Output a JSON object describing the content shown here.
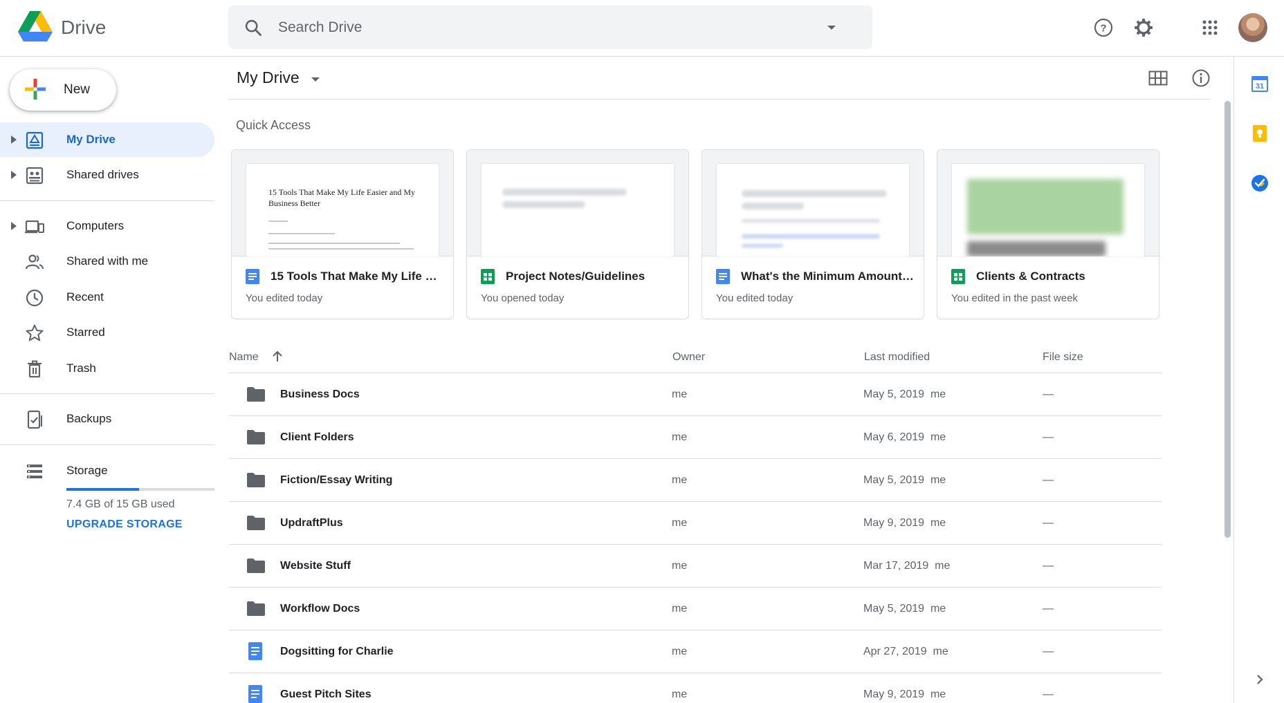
{
  "header": {
    "brand": "Drive",
    "search_placeholder": "Search Drive"
  },
  "sidebar": {
    "new_label": "New",
    "items": [
      {
        "label": "My Drive",
        "icon": "my-drive-icon",
        "active": true
      },
      {
        "label": "Shared drives",
        "icon": "shared-drives-icon"
      },
      {
        "label": "Computers",
        "icon": "computers-icon"
      },
      {
        "label": "Shared with me",
        "icon": "shared-with-me-icon"
      },
      {
        "label": "Recent",
        "icon": "clock-icon"
      },
      {
        "label": "Starred",
        "icon": "star-icon"
      },
      {
        "label": "Trash",
        "icon": "trash-icon"
      },
      {
        "label": "Backups",
        "icon": "backups-icon"
      },
      {
        "label": "Storage",
        "icon": "storage-icon"
      }
    ],
    "storage": {
      "used_fraction": 0.49,
      "text": "7.4 GB of 15 GB used",
      "upgrade": "UPGRADE STORAGE"
    }
  },
  "main": {
    "title": "My Drive",
    "quick_access": {
      "title": "Quick Access",
      "cards": [
        {
          "name": "15 Tools That Make My Life Ea...",
          "sub": "You edited today",
          "type": "doc",
          "preview_title": "15 Tools That Make My Life Easier and My Business Better"
        },
        {
          "name": "Project Notes/Guidelines",
          "sub": "You opened today",
          "type": "sheet"
        },
        {
          "name": "What's the Minimum Amount o...",
          "sub": "You edited today",
          "type": "doc"
        },
        {
          "name": "Clients & Contracts",
          "sub": "You edited in the past week",
          "type": "sheet"
        }
      ]
    },
    "list": {
      "columns": {
        "name": "Name",
        "owner": "Owner",
        "modified": "Last modified",
        "size": "File size"
      },
      "rows": [
        {
          "name": "Business Docs",
          "type": "folder",
          "owner": "me",
          "modified": "May 5, 2019",
          "modified_by": "me",
          "size": "—"
        },
        {
          "name": "Client Folders",
          "type": "folder",
          "owner": "me",
          "modified": "May 6, 2019",
          "modified_by": "me",
          "size": "—"
        },
        {
          "name": "Fiction/Essay Writing",
          "type": "folder",
          "owner": "me",
          "modified": "May 5, 2019",
          "modified_by": "me",
          "size": "—"
        },
        {
          "name": "UpdraftPlus",
          "type": "folder",
          "owner": "me",
          "modified": "May 9, 2019",
          "modified_by": "me",
          "size": "—"
        },
        {
          "name": "Website Stuff",
          "type": "folder",
          "owner": "me",
          "modified": "Mar 17, 2019",
          "modified_by": "me",
          "size": "—"
        },
        {
          "name": "Workflow Docs",
          "type": "folder",
          "owner": "me",
          "modified": "May 5, 2019",
          "modified_by": "me",
          "size": "—"
        },
        {
          "name": "Dogsitting for Charlie",
          "type": "doc",
          "owner": "me",
          "modified": "Apr 27, 2019",
          "modified_by": "me",
          "size": "—"
        },
        {
          "name": "Guest Pitch Sites",
          "type": "doc",
          "owner": "me",
          "modified": "May 9, 2019",
          "modified_by": "me",
          "size": "—"
        }
      ]
    }
  },
  "side_panel": {
    "calendar_text": "31"
  },
  "colors": {
    "accent": "#1a73e8",
    "active_bg": "#e8f0fe",
    "doc_blue": "#4285f4",
    "sheet_green": "#0f9d58",
    "folder_gray": "#5f6368",
    "keep_yellow": "#fbbc04"
  }
}
